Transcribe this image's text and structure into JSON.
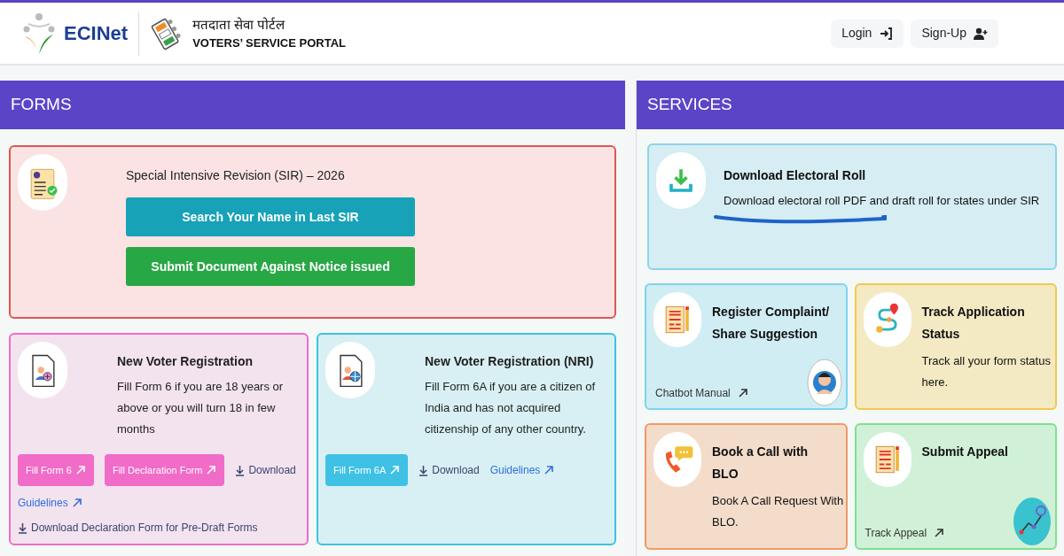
{
  "header": {
    "logo_text": "ECINet",
    "portal_title_hindi": "मतदाता सेवा पोर्टल",
    "portal_title": "VOTERS’ SERVICE PORTAL",
    "buttons": [
      {
        "label": "Login",
        "kind": "login"
      },
      {
        "label": "Sign-Up",
        "kind": "signup"
      }
    ]
  },
  "forms": {
    "title": "FORMS",
    "sir": {
      "title": "Special Intensive Revision (SIR) – 2026",
      "buttons": [
        {
          "label": "Search Your Name in Last SIR",
          "color": "#17a2b8"
        },
        {
          "label": "Submit Document Against Notice issued",
          "color": "#28a745"
        }
      ]
    },
    "cards": [
      {
        "kind": "voter",
        "color": "#f06cc8",
        "title": "New Voter Registration",
        "description": "Fill Form 6 if you are 18 years or above or you will turn 18 in few months",
        "links": [
          {
            "kind": "button",
            "label": "Fill Form 6"
          },
          {
            "kind": "button",
            "label": "Fill Declaration Form"
          },
          {
            "kind": "download",
            "label": "Download"
          },
          {
            "kind": "external",
            "label": "Guidelines"
          },
          {
            "kind": "download",
            "label": "Download Declaration Form for Pre-Draft Forms"
          }
        ]
      },
      {
        "kind": "nri",
        "color": "#3fc1e6",
        "title": "New Voter Registration (NRI)",
        "description": "Fill Form 6A if you are a citizen of India and has not acquired citizenship of any other country.",
        "links": [
          {
            "kind": "button",
            "label": "Fill Form 6A"
          },
          {
            "kind": "download",
            "label": "Download"
          },
          {
            "kind": "external",
            "label": "Guidelines"
          }
        ]
      }
    ]
  },
  "services": {
    "title": "SERVICES",
    "featured": {
      "kind": "download",
      "color": "#8fd3ec",
      "title": "Download Electoral Roll",
      "description": "Download electoral roll PDF and draft roll for states under SIR"
    },
    "cards": [
      {
        "kind": "complaint",
        "color": "#7fd3f0",
        "title": "Register Complaint/ Share Suggestion",
        "link": "Chatbot Manual",
        "badge": {
          "kind": "chatbot"
        }
      },
      {
        "kind": "track",
        "color": "#f2c94c",
        "title": "Track Application Status",
        "description": "Track all your form status here."
      },
      {
        "kind": "call",
        "color": "#f19a64",
        "title": "Book a Call with BLO",
        "description": "Book A Call Request With BLO."
      },
      {
        "kind": "appeal",
        "color": "#7fe08f",
        "title": "Submit Appeal",
        "link": "Track Appeal",
        "badge": {
          "kind": "route"
        }
      }
    ]
  }
}
